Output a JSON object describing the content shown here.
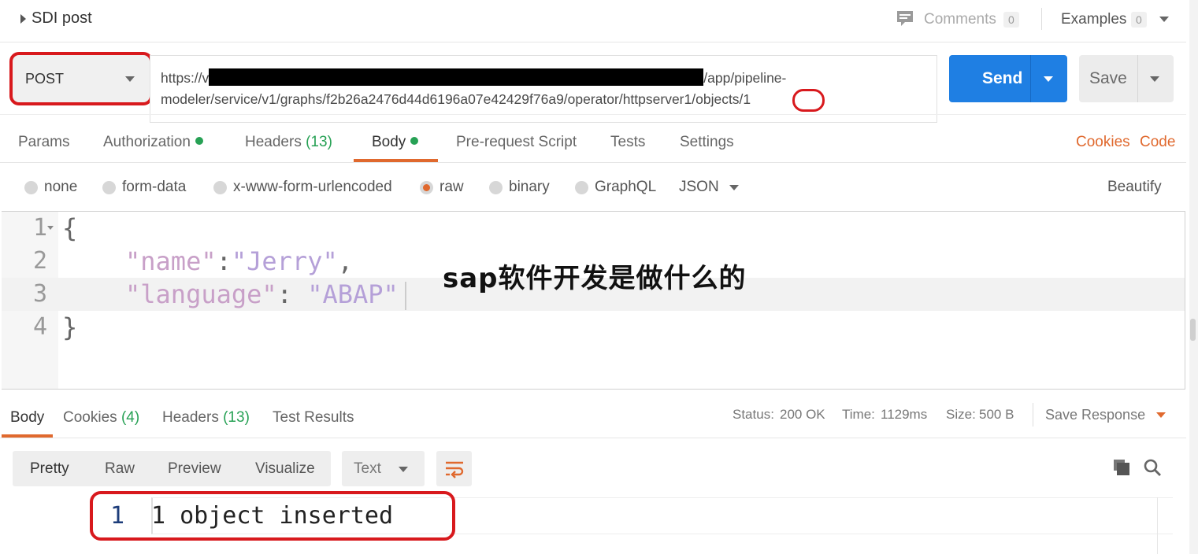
{
  "header": {
    "request_name": "SDI post",
    "comments_label": "Comments",
    "comments_count": "0",
    "examples_label": "Examples",
    "examples_count": "0"
  },
  "request": {
    "method": "POST",
    "url_line1_prefix": "https://v",
    "url_line1_suffix": "/app/pipeline-",
    "url_line2": "modeler/service/v1/graphs/f2b26a2476d44d6196a07e42429f76a9/operator/httpserver1/objects/1",
    "send_label": "Send",
    "save_label": "Save"
  },
  "request_tabs": {
    "params": "Params",
    "authorization": "Authorization",
    "headers": "Headers",
    "headers_count": "(13)",
    "body": "Body",
    "prerequest": "Pre-request Script",
    "tests": "Tests",
    "settings": "Settings",
    "cookies": "Cookies",
    "code": "Code"
  },
  "body_types": {
    "none": "none",
    "form_data": "form-data",
    "urlencoded": "x-www-form-urlencoded",
    "raw": "raw",
    "binary": "binary",
    "graphql": "GraphQL",
    "format": "JSON",
    "beautify": "Beautify"
  },
  "editor": {
    "line_numbers": [
      "1",
      "2",
      "3",
      "4"
    ],
    "open_brace": "{",
    "line2_key": "\"name\"",
    "line2_colon": ":",
    "line2_value": "\"Jerry\"",
    "line2_comma": ",",
    "line3_key": "\"language\"",
    "line3_colon": ": ",
    "line3_value": "\"ABAP\"",
    "close_brace": "}"
  },
  "overlay_text": "sap软件开发是做什么的",
  "response_tabs": {
    "body": "Body",
    "cookies": "Cookies",
    "cookies_count": "(4)",
    "headers": "Headers",
    "headers_count": "(13)",
    "test_results": "Test Results"
  },
  "response_meta": {
    "status_label": "Status:",
    "status_value": "200 OK",
    "time_label": "Time:",
    "time_value": "1129ms",
    "size_label": "Size:",
    "size_value": "500 B",
    "save_response": "Save Response"
  },
  "response_view": {
    "pretty": "Pretty",
    "raw": "Raw",
    "preview": "Preview",
    "visualize": "Visualize",
    "format": "Text",
    "line_number": "1",
    "content": "1 object inserted"
  },
  "colors": {
    "accent_orange": "#e0692e",
    "send_blue": "#1f7fe3",
    "ok_green": "#27a155",
    "highlight_red": "#d8191d"
  }
}
